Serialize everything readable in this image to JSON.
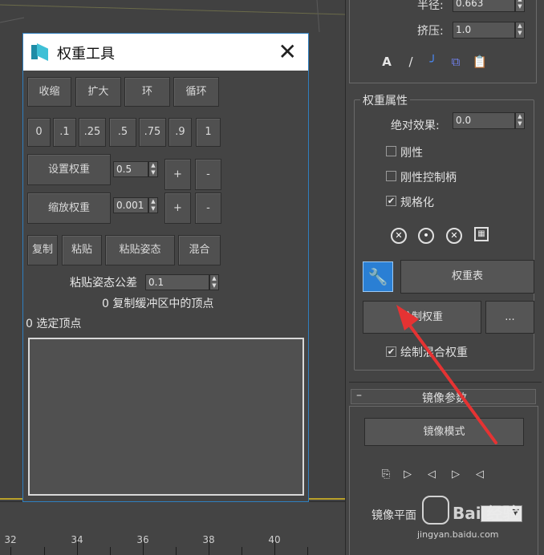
{
  "dialog": {
    "title": "权重工具",
    "close_symbol": "✕",
    "row1": [
      "收缩",
      "扩大",
      "环",
      "循环"
    ],
    "presets": [
      "0",
      ".1",
      ".25",
      ".5",
      ".75",
      ".9",
      "1"
    ],
    "set_weight_label": "设置权重",
    "set_weight_value": "0.5",
    "scale_weight_label": "缩放权重",
    "scale_weight_value": "0.001",
    "plus": "+",
    "minus": "-",
    "row_copy": [
      "复制",
      "粘贴",
      "粘贴姿态",
      "混合"
    ],
    "paste_tolerance_label": "粘贴姿态公差",
    "paste_tolerance_value": "0.1",
    "buffer_status": "0 复制缓冲区中的顶点",
    "selected_status": "0 选定顶点"
  },
  "panel": {
    "radius_label": "半径:",
    "radius_value": "0.663",
    "squash_label": "挤压:",
    "squash_value": "1.0",
    "weight_props_title": "权重属性",
    "abs_effect_label": "绝对效果:",
    "abs_effect_value": "0.0",
    "rigid_label": "刚性",
    "rigid_handles_label": "刚性控制柄",
    "normalize_label": "规格化",
    "normalize_checkmark": "✔",
    "weight_table_label": "权重表",
    "paint_weights_label": "绘制权重",
    "ellipsis_label": "...",
    "paint_blend_label": "绘制混合权重",
    "paint_blend_checkmark": "✔",
    "mirror_rollout_title": "镜像参数",
    "collapse_symbol": "–",
    "mirror_mode_label": "镜像模式",
    "mirror_plane_label": "镜像平面"
  },
  "timeline": {
    "labels": [
      "32",
      "34",
      "36",
      "38",
      "40"
    ]
  },
  "watermark": {
    "brand": "Bai 经验",
    "url": "jingyan.baidu.com"
  },
  "colors": {
    "dialog_border": "#2f7fbf",
    "wrench_button": "#2a7fd4",
    "arrow": "#e53333",
    "panel_bg": "#444444",
    "viewport_grid": "#6b6b4a"
  },
  "icons": {
    "app_logo": "3ds-max-logo-icon",
    "wrench": "wrench-icon",
    "close": "close-icon"
  }
}
